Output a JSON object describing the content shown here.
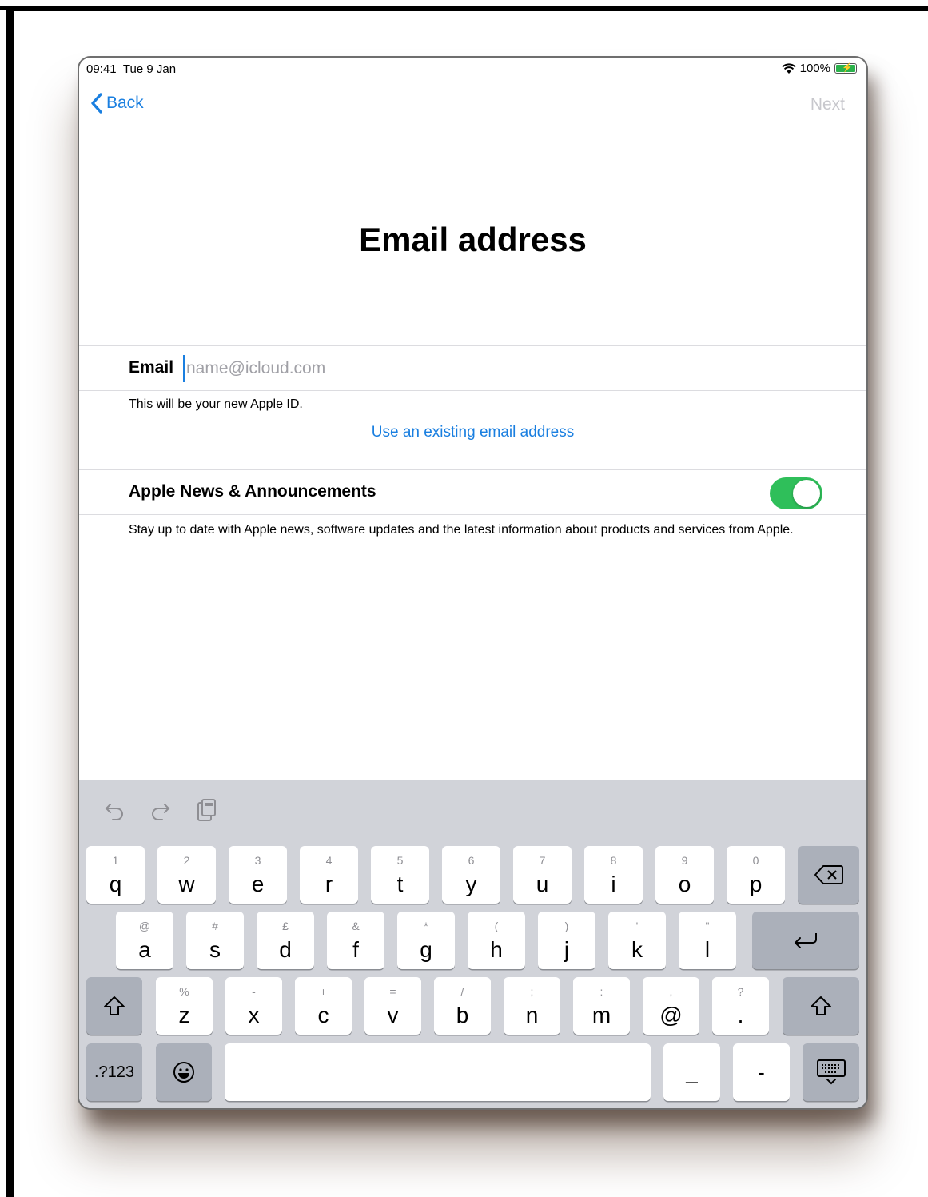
{
  "status_bar": {
    "time": "09:41",
    "date": "Tue 9 Jan",
    "battery": "100%"
  },
  "nav": {
    "back_label": "Back",
    "next_label": "Next"
  },
  "title": "Email address",
  "email": {
    "label": "Email",
    "placeholder": "name@icloud.com",
    "hint": "This will be your new Apple ID.",
    "alt_link": "Use an existing email address"
  },
  "news": {
    "label": "Apple News & Announcements",
    "toggle_on": true,
    "description": "Stay up to date with Apple news, software updates and the latest information about products and services from Apple."
  },
  "keyboard": {
    "toolbar": [
      "undo-icon",
      "redo-icon",
      "paste-icon"
    ],
    "row1": [
      {
        "k": "q",
        "h": "1"
      },
      {
        "k": "w",
        "h": "2"
      },
      {
        "k": "e",
        "h": "3"
      },
      {
        "k": "r",
        "h": "4"
      },
      {
        "k": "t",
        "h": "5"
      },
      {
        "k": "y",
        "h": "6"
      },
      {
        "k": "u",
        "h": "7"
      },
      {
        "k": "i",
        "h": "8"
      },
      {
        "k": "o",
        "h": "9"
      },
      {
        "k": "p",
        "h": "0"
      }
    ],
    "row2": [
      {
        "k": "a",
        "h": "@"
      },
      {
        "k": "s",
        "h": "#"
      },
      {
        "k": "d",
        "h": "£"
      },
      {
        "k": "f",
        "h": "&"
      },
      {
        "k": "g",
        "h": "*"
      },
      {
        "k": "h",
        "h": "("
      },
      {
        "k": "j",
        "h": ")"
      },
      {
        "k": "k",
        "h": "'"
      },
      {
        "k": "l",
        "h": "\""
      }
    ],
    "row3": [
      {
        "k": "z",
        "h": "%"
      },
      {
        "k": "x",
        "h": "-"
      },
      {
        "k": "c",
        "h": "+"
      },
      {
        "k": "v",
        "h": "="
      },
      {
        "k": "b",
        "h": "/"
      },
      {
        "k": "n",
        "h": ";"
      },
      {
        "k": "m",
        "h": ":"
      },
      {
        "k": "@",
        "h": ","
      },
      {
        "k": ".",
        "h": "?"
      }
    ],
    "numbers_label": ".?123",
    "underscore": "_",
    "dash": "-"
  },
  "colors": {
    "accent": "#1a7fe0",
    "toggle": "#2fbf5a",
    "keyboard_bg": "#d1d3d9"
  }
}
